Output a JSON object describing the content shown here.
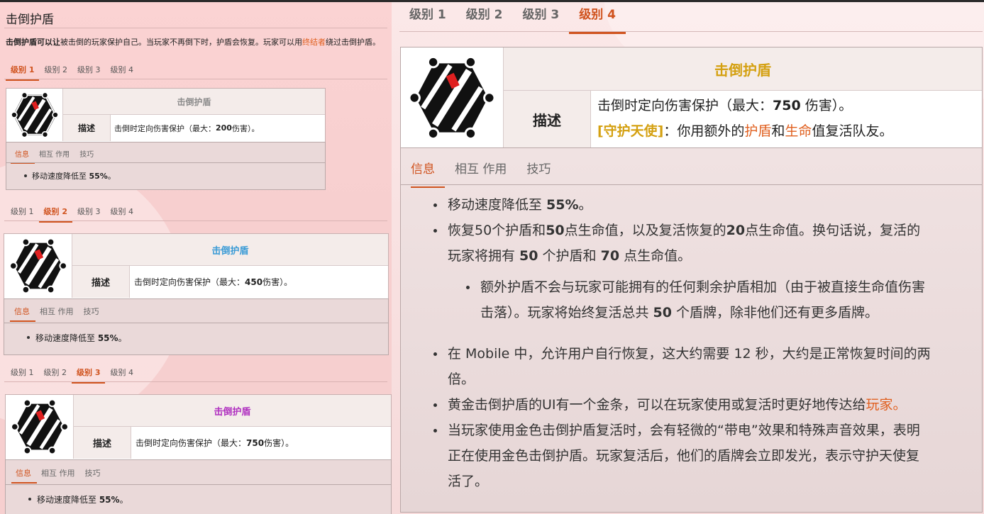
{
  "page": {
    "title": "击倒护盾",
    "intro_bold": "击倒护盾可以让",
    "intro_mid": "被击倒的玩家保护自己。当玩家不再倒下时，护盾会恢复。玩家可以用",
    "intro_link": "终结者",
    "intro_end": "绕过击倒护盾。"
  },
  "level_tabs": [
    "级别 1",
    "级别 2",
    "级别 3",
    "级别 4"
  ],
  "info_tabs": [
    "信息",
    "相互 作用",
    "技巧"
  ],
  "item_name": "击倒护盾",
  "desc_label": "描述",
  "colors": {
    "level1_name": "#8c8c8c",
    "level2_name": "#3a9bd6",
    "level3_name": "#b030c0",
    "level4_name": "#d4a010",
    "accent": "#d0531e"
  },
  "levels": [
    {
      "active": 0,
      "desc_pre": "击倒时定向伤害保护（最大：",
      "desc_num": "200",
      "desc_post": " 伤害）。",
      "info_pre": "移动速度降低至 ",
      "info_num": "55%",
      "info_post": "。"
    },
    {
      "active": 1,
      "desc_pre": "击倒时定向伤害保护（最大：",
      "desc_num": "450",
      "desc_post": " 伤害）。",
      "info_pre": "移动速度降低至 ",
      "info_num": "55%",
      "info_post": "。"
    },
    {
      "active": 2,
      "desc_pre": "击倒时定向伤害保护（最大：",
      "desc_num": "750",
      "desc_post": " 伤害）。",
      "info_pre": "移动速度降低至 ",
      "info_num": "55%",
      "info_post": "。"
    }
  ],
  "level4": {
    "desc_pre": "击倒时定向伤害保护（最大：",
    "desc_num": "750",
    "desc_post": " 伤害）。",
    "perk_name": "[守护天使]",
    "perk_pre": "：你用额外的",
    "perk_shield": "护盾",
    "perk_and": "和",
    "perk_health": "生命",
    "perk_post": "值复活队友。",
    "b1_pre": "移动速度降低至 ",
    "b1_num": "55%",
    "b1_post": "。",
    "b2_a": "恢复50个护盾和",
    "b2_b": "50",
    "b2_c": "点生命值，以及复活恢复的",
    "b2_d": "20",
    "b2_e": "点生命值。换句话说，复活的",
    "b2_f": "玩家将拥有 ",
    "b2_g": "50",
    "b2_h": " 个护盾和 ",
    "b2_i": "70",
    "b2_j": " 点生命值。",
    "b2s_a": "额外护盾不会与玩家可能拥有的任何剩余护盾相加（由于被直接生命值伤害",
    "b2s_b": "击落）。玩家将始终复活总共 ",
    "b2s_c": "50",
    "b2s_d": " 个盾牌，除非他们还有更多盾牌。",
    "b3_a": "在 Mobile 中，允许用户自行恢复，这大约需要 12 秒，大约是正常恢复时间的两",
    "b3_b": "倍。",
    "b4_a": "黄金击倒护盾的UI有一个金条，可以在玩家使用或复活时更好地传达给",
    "b4_link": "玩家。",
    "b5_a": "当玩家使用金色击倒护盾复活时，会有轻微的“带电”效果和特殊声音效果，表明",
    "b5_b": "正在使用金色击倒护盾。玩家复活后，他们的盾牌会立即发光，表示守护天使复",
    "b5_c": "活了。"
  }
}
